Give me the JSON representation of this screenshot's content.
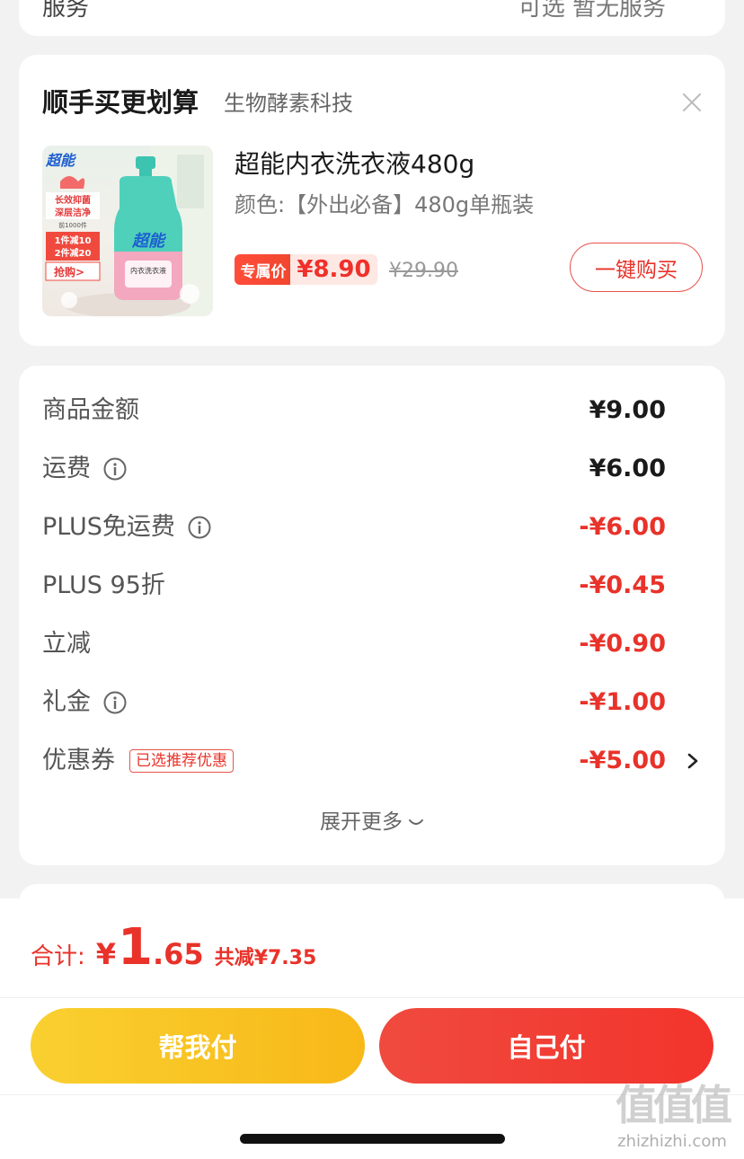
{
  "top_card": {
    "left_partial": "服务",
    "right_partial": "可选 暂无服务"
  },
  "addon": {
    "title": "顺手买更划算",
    "subtitle": "生物酵素科技",
    "product": {
      "name": "超能内衣洗衣液480g",
      "variant": "颜色:【外出必备】480g单瓶装",
      "price_tag": "专属价",
      "price": "¥8.90",
      "original_price": "¥29.90",
      "buy_label": "一键购买",
      "image_texts": {
        "brand": "超能",
        "line1": "长效抑菌",
        "line2": "深层洁净",
        "promo_small": "前1000件",
        "promo1": "1件减10",
        "promo2": "2件减20",
        "cta": "抢购>",
        "bottle_label": "内衣洗衣液"
      }
    }
  },
  "summary": {
    "rows": [
      {
        "label": "商品金额",
        "value": "¥9.00",
        "negative": false
      },
      {
        "label": "运费",
        "value": "¥6.00",
        "negative": false,
        "info": true
      },
      {
        "label": "PLUS免运费",
        "value": "-¥6.00",
        "negative": true,
        "info": true
      },
      {
        "label": "PLUS 95折",
        "value": "-¥0.45",
        "negative": true
      },
      {
        "label": "立减",
        "value": "-¥0.90",
        "negative": true
      },
      {
        "label": "礼金",
        "value": "-¥1.00",
        "negative": true,
        "info": true
      },
      {
        "label": "优惠券",
        "value": "-¥5.00",
        "negative": true,
        "badge": "已选推荐优惠"
      }
    ],
    "expand_label": "展开更多"
  },
  "footer": {
    "total_label": "合计:",
    "total_currency": "¥",
    "total_int": "1",
    "total_dec": ".65",
    "total_saved": "共减¥7.35",
    "help_pay_label": "帮我付",
    "self_pay_label": "自己付"
  },
  "watermark": {
    "logo": "值值值",
    "url": "zhizhizhi.com"
  },
  "colors": {
    "accent_red": "#e8322a",
    "yellow": "#f8c020",
    "bg": "#f2f2f2"
  }
}
